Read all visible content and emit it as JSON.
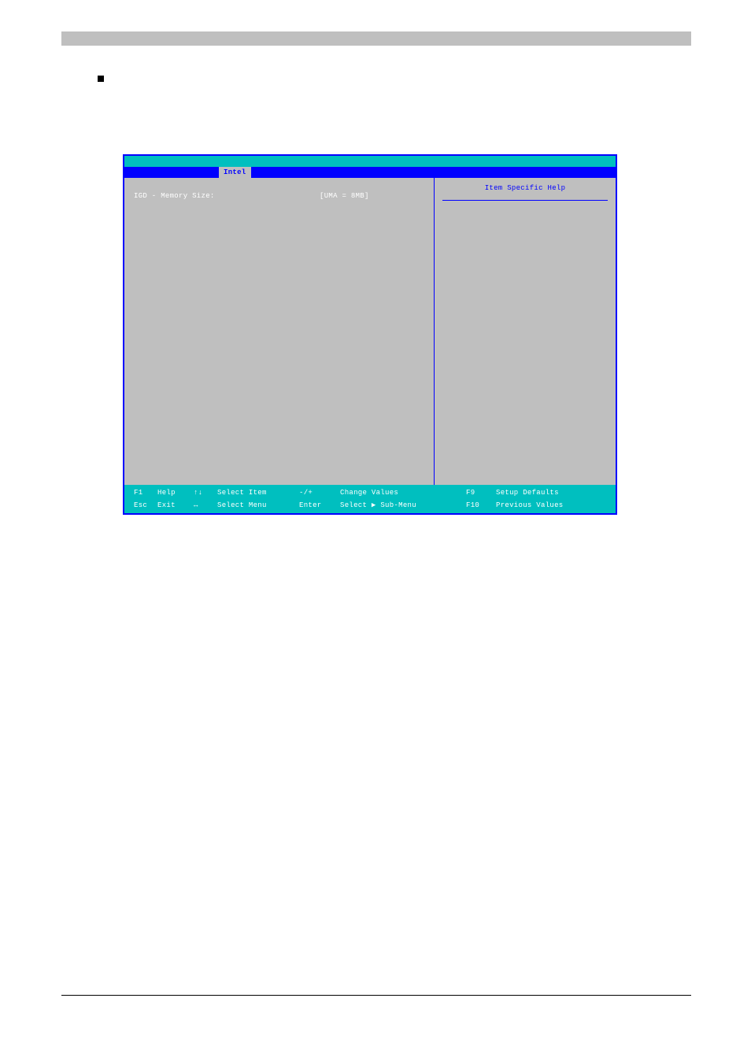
{
  "bios": {
    "title_pill": "Intel",
    "help_title": "Item Specific Help",
    "setting": {
      "label": "IGD - Memory Size:",
      "value": "[UMA = 8MB]"
    },
    "footer_row1": {
      "key1": "F1",
      "lbl1": "Help",
      "sym1": "↑↓",
      "lbl2": "Select Item",
      "key2": "-/+",
      "lbl3": "Change Values",
      "key3": "F9",
      "lbl4": "Setup Defaults"
    },
    "footer_row2": {
      "key1": "Esc",
      "lbl1": "Exit",
      "sym1": "↔",
      "lbl2": "Select Menu",
      "key2": "Enter",
      "lbl3": "Select ▶ Sub-Menu",
      "key3": "F10",
      "lbl4": "Previous Values"
    }
  }
}
